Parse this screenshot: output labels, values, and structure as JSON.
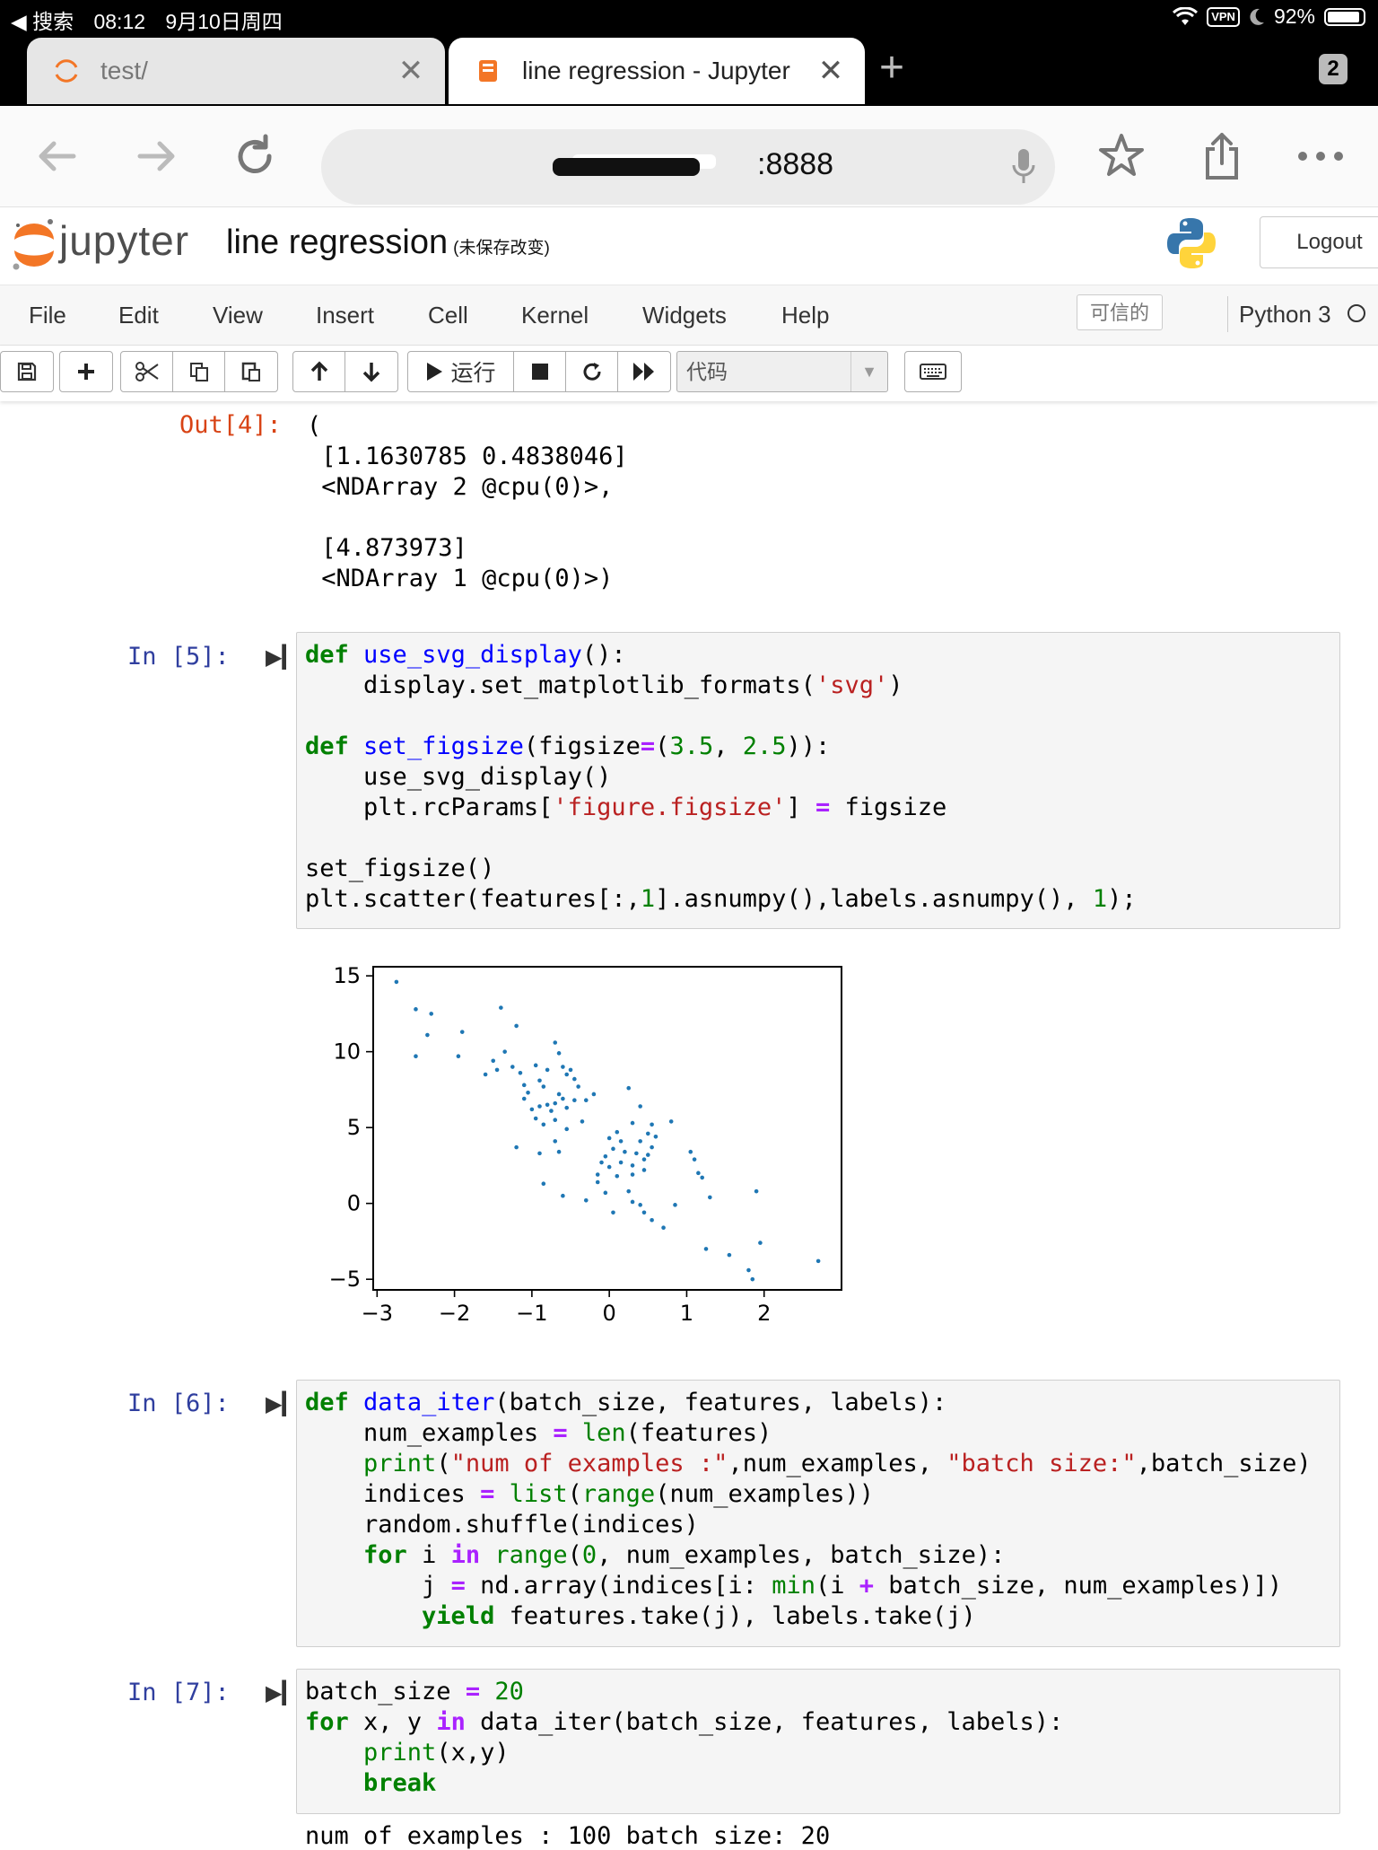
{
  "status_bar": {
    "back_app": "◀ 搜索",
    "time": "08:12",
    "date": "9月10日周四",
    "vpn": "VPN",
    "battery": "92%",
    "battery_level": 0.92
  },
  "tabs": [
    {
      "title": "test/",
      "active": false
    },
    {
      "title": "line regression - Jupyter",
      "active": true
    }
  ],
  "tab_count": "2",
  "url": ":8888",
  "jupyter": {
    "logo_text": "jupyter",
    "notebook_title": "line regression",
    "unsaved": "(未保存改变)",
    "logout": "Logout"
  },
  "menu": [
    "File",
    "Edit",
    "View",
    "Insert",
    "Cell",
    "Kernel",
    "Widgets",
    "Help"
  ],
  "trusted": "可信的",
  "kernel_name": "Python 3",
  "toolbar": {
    "run_label": "运行",
    "cell_type": "代码"
  },
  "out4": {
    "prompt": "Out[4]:",
    "text": "(\n [1.1630785 0.4838046]\n <NDArray 2 @cpu(0)>,\n\n [4.873973]\n <NDArray 1 @cpu(0)>)"
  },
  "cells": [
    {
      "prompt": "In [5]:"
    },
    {
      "prompt": "In [6]:"
    },
    {
      "prompt": "In [7]:"
    }
  ],
  "bottom_output": "num of examples : 100 batch size: 20",
  "chart_data": {
    "type": "scatter",
    "title": "",
    "xlabel": "",
    "ylabel": "",
    "xlim": [
      -3.05,
      3.0
    ],
    "ylim": [
      -5.7,
      15.6
    ],
    "xticks": [
      -3,
      -2,
      -1,
      0,
      1,
      2
    ],
    "yticks": [
      -5,
      0,
      5,
      10,
      15
    ],
    "xtick_labels": [
      "−3",
      "−2",
      "−1",
      "0",
      "1",
      "2"
    ],
    "ytick_labels": [
      "−5",
      "0",
      "5",
      "10",
      "15"
    ],
    "grid": false,
    "color": "#1f77b4",
    "points": [
      [
        -2.75,
        14.6
      ],
      [
        -2.5,
        12.8
      ],
      [
        -2.3,
        12.5
      ],
      [
        -2.35,
        11.1
      ],
      [
        -2.5,
        9.7
      ],
      [
        -1.9,
        11.3
      ],
      [
        -1.95,
        9.7
      ],
      [
        -1.4,
        12.9
      ],
      [
        -1.2,
        11.7
      ],
      [
        -1.35,
        10.0
      ],
      [
        -1.5,
        9.4
      ],
      [
        -1.45,
        8.8
      ],
      [
        -1.6,
        8.5
      ],
      [
        -1.25,
        9.0
      ],
      [
        -1.15,
        8.6
      ],
      [
        -1.1,
        7.8
      ],
      [
        -1.05,
        7.3
      ],
      [
        -1.1,
        6.9
      ],
      [
        -0.95,
        9.1
      ],
      [
        -0.9,
        8.1
      ],
      [
        -0.85,
        7.7
      ],
      [
        -0.8,
        8.8
      ],
      [
        -0.7,
        10.6
      ],
      [
        -0.65,
        9.9
      ],
      [
        -0.6,
        9.0
      ],
      [
        -0.55,
        8.5
      ],
      [
        -0.5,
        8.8
      ],
      [
        -0.45,
        8.2
      ],
      [
        -0.4,
        7.7
      ],
      [
        -0.45,
        6.8
      ],
      [
        -0.55,
        6.3
      ],
      [
        -0.6,
        6.9
      ],
      [
        -0.7,
        6.6
      ],
      [
        -0.75,
        6.1
      ],
      [
        -0.8,
        6.5
      ],
      [
        -0.9,
        6.4
      ],
      [
        -0.95,
        5.6
      ],
      [
        -1.0,
        6.2
      ],
      [
        -0.85,
        5.2
      ],
      [
        -0.7,
        5.5
      ],
      [
        -0.55,
        4.9
      ],
      [
        -0.35,
        5.4
      ],
      [
        -0.3,
        6.8
      ],
      [
        -1.2,
        3.7
      ],
      [
        -0.9,
        3.3
      ],
      [
        -0.7,
        4.1
      ],
      [
        -0.65,
        3.4
      ],
      [
        -0.85,
        1.3
      ],
      [
        -0.6,
        0.5
      ],
      [
        0.0,
        4.3
      ],
      [
        0.1,
        4.7
      ],
      [
        0.15,
        4.1
      ],
      [
        0.05,
        3.6
      ],
      [
        -0.05,
        3.1
      ],
      [
        0.2,
        3.4
      ],
      [
        0.0,
        2.4
      ],
      [
        0.15,
        2.7
      ],
      [
        0.3,
        2.5
      ],
      [
        0.35,
        3.3
      ],
      [
        0.4,
        4.1
      ],
      [
        0.45,
        2.9
      ],
      [
        0.5,
        4.6
      ],
      [
        0.55,
        5.2
      ],
      [
        0.6,
        4.4
      ],
      [
        0.55,
        3.7
      ],
      [
        0.5,
        3.2
      ],
      [
        0.45,
        2.2
      ],
      [
        0.3,
        1.9
      ],
      [
        0.1,
        1.8
      ],
      [
        -0.15,
        1.9
      ],
      [
        -0.1,
        2.7
      ],
      [
        -0.15,
        1.4
      ],
      [
        -0.05,
        0.7
      ],
      [
        0.25,
        0.8
      ],
      [
        0.3,
        0.1
      ],
      [
        0.4,
        -0.1
      ],
      [
        0.45,
        -0.6
      ],
      [
        0.05,
        -0.6
      ],
      [
        -0.3,
        0.2
      ],
      [
        0.55,
        -1.1
      ],
      [
        0.7,
        -1.6
      ],
      [
        0.8,
        5.4
      ],
      [
        0.3,
        5.3
      ],
      [
        0.25,
        7.6
      ],
      [
        0.4,
        6.4
      ],
      [
        0.85,
        -0.1
      ],
      [
        1.05,
        3.4
      ],
      [
        1.1,
        2.9
      ],
      [
        1.15,
        2.0
      ],
      [
        1.2,
        1.7
      ],
      [
        1.3,
        0.4
      ],
      [
        1.25,
        -3.0
      ],
      [
        1.55,
        -3.4
      ],
      [
        1.8,
        -4.4
      ],
      [
        1.85,
        -5.0
      ],
      [
        1.9,
        0.8
      ],
      [
        1.95,
        -2.6
      ],
      [
        2.7,
        -3.8
      ],
      [
        -0.65,
        7.2
      ],
      [
        -0.2,
        7.2
      ]
    ]
  }
}
